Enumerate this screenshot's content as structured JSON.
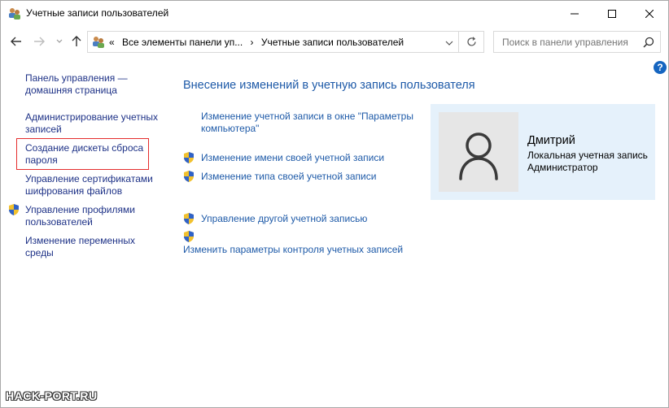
{
  "window": {
    "title": "Учетные записи пользователей"
  },
  "address_bar": {
    "overflow": "«",
    "crumbs": [
      "Все элементы панели уп...",
      "›",
      "Учетные записи пользователей"
    ]
  },
  "search": {
    "placeholder": "Поиск в панели управления"
  },
  "help_label": "?",
  "left_pane": {
    "home_line1": "Панель управления —",
    "home_line2": "домашняя страница",
    "admin_line1": "Администрирование учетных",
    "admin_line2": "записей",
    "reset_line1": "Создание дискеты сброса",
    "reset_line2": "пароля",
    "certs_line1": "Управление сертификатами",
    "certs_line2": "шифрования файлов",
    "profiles_line1": "Управление профилями",
    "profiles_line2": "пользователей",
    "env_line1": "Изменение переменных",
    "env_line2": "среды"
  },
  "main": {
    "heading": "Внесение изменений в учетную запись пользователя",
    "pc_settings_line1": "Изменение учетной записи в окне \"Параметры",
    "pc_settings_line2": "компьютера\"",
    "rename": "Изменение имени своей учетной записи",
    "change_type": "Изменение типа своей учетной записи",
    "manage_other": "Управление другой учетной записью",
    "uac": "Изменить параметры контроля учетных записей"
  },
  "user_card": {
    "name": "Дмитрий",
    "account_type": "Локальная учетная запись",
    "role": "Администратор"
  },
  "watermark": "HACK-PORT.RU",
  "colors": {
    "link": "#1e5aa8",
    "left_link": "#1e3287",
    "card_bg": "#e5f1fb",
    "highlight_border": "#e52d2d"
  }
}
